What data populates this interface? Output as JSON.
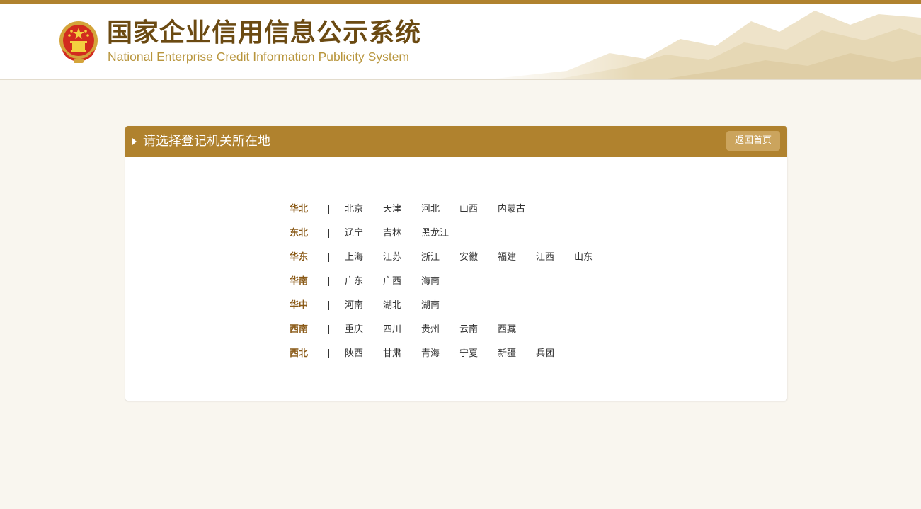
{
  "header": {
    "title_cn": "国家企业信用信息公示系统",
    "title_en": "National Enterprise Credit Information Publicity System"
  },
  "panel": {
    "title": "请选择登记机关所在地",
    "home_button": "返回首页"
  },
  "regions": [
    {
      "name": "华北",
      "provinces": [
        "北京",
        "天津",
        "河北",
        "山西",
        "内蒙古"
      ]
    },
    {
      "name": "东北",
      "provinces": [
        "辽宁",
        "吉林",
        "黑龙江"
      ]
    },
    {
      "name": "华东",
      "provinces": [
        "上海",
        "江苏",
        "浙江",
        "安徽",
        "福建",
        "江西",
        "山东"
      ]
    },
    {
      "name": "华南",
      "provinces": [
        "广东",
        "广西",
        "海南"
      ]
    },
    {
      "name": "华中",
      "provinces": [
        "河南",
        "湖北",
        "湖南"
      ]
    },
    {
      "name": "西南",
      "provinces": [
        "重庆",
        "四川",
        "贵州",
        "云南",
        "西藏"
      ]
    },
    {
      "name": "西北",
      "provinces": [
        "陕西",
        "甘肃",
        "青海",
        "宁夏",
        "新疆",
        "兵团"
      ]
    }
  ],
  "colors": {
    "accent": "#b0822e",
    "button": "#cba45d",
    "region_label": "#8a5a17",
    "background": "#f9f6ef"
  }
}
